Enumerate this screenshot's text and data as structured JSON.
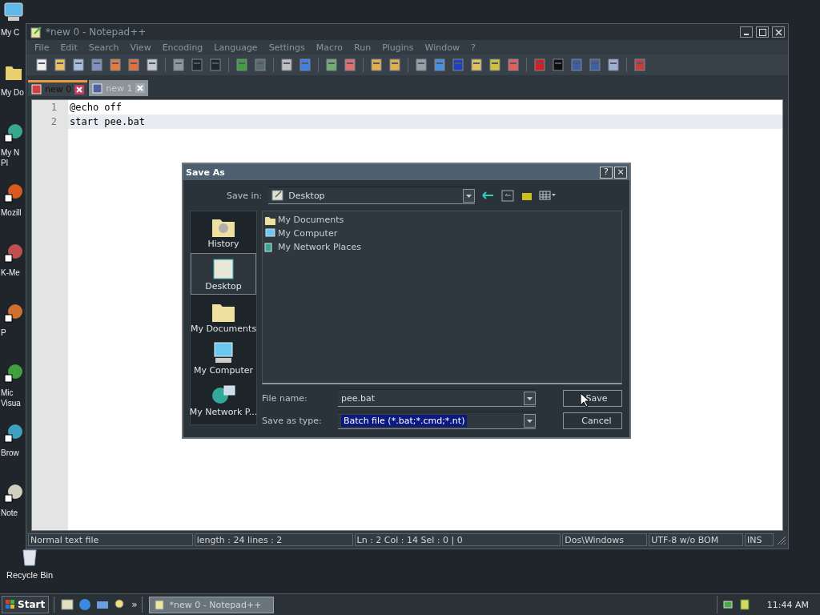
{
  "desktop_icons": [
    {
      "label_lines": [
        "My C"
      ]
    },
    {
      "label_lines": [
        "My Do"
      ]
    },
    {
      "label_lines": [
        "My N",
        "Pl"
      ]
    },
    {
      "label_lines": [
        "Mozill"
      ]
    },
    {
      "label_lines": [
        "K-Me"
      ]
    },
    {
      "label_lines": [
        "P"
      ]
    },
    {
      "label_lines": [
        "Mic",
        "Visua"
      ]
    },
    {
      "label_lines": [
        "Brow"
      ]
    },
    {
      "label_lines": [
        "Note"
      ]
    },
    {
      "label_lines": [
        "Recycle Bin"
      ]
    }
  ],
  "window": {
    "title": "*new  0 - Notepad++",
    "menu": [
      "File",
      "Edit",
      "Search",
      "View",
      "Encoding",
      "Language",
      "Settings",
      "Macro",
      "Run",
      "Plugins",
      "Window",
      "?"
    ],
    "tabs": [
      {
        "label": "new  0",
        "selected": true
      },
      {
        "label": "new  1",
        "selected": false
      }
    ],
    "editor": {
      "lines": [
        {
          "number": "1",
          "text": "@echo off",
          "current": false
        },
        {
          "number": "2",
          "text": "start pee.bat",
          "current": true
        }
      ]
    },
    "status_bar": [
      "Normal text file",
      "length : 24    lines : 2",
      "Ln : 2    Col : 14    Sel : 0 | 0",
      "Dos\\Windows",
      "UTF-8 w/o BOM",
      "INS"
    ]
  },
  "dialog": {
    "title": "Save As",
    "help": "?",
    "close": "×",
    "save_in_label": "Save in:",
    "save_in": "Desktop",
    "places": [
      {
        "label": "History",
        "selected": false
      },
      {
        "label": "Desktop",
        "selected": true
      },
      {
        "label": "My Documents",
        "selected": false
      },
      {
        "label": "My Computer",
        "selected": false
      },
      {
        "label": "My Network P...",
        "selected": false
      }
    ],
    "files": [
      "My Documents",
      "My Computer",
      "My Network Places"
    ],
    "file_name_label": "File name:",
    "file_name": "pee.bat",
    "type_label": "Save as type:",
    "type": "Batch file (*.bat;*.cmd;*.nt)",
    "buttons": [
      "Save",
      "Cancel"
    ]
  },
  "taskbar": {
    "start": "Start",
    "more": "»",
    "task": "*new  0 - Notepad++",
    "clock": "11:44 AM"
  }
}
